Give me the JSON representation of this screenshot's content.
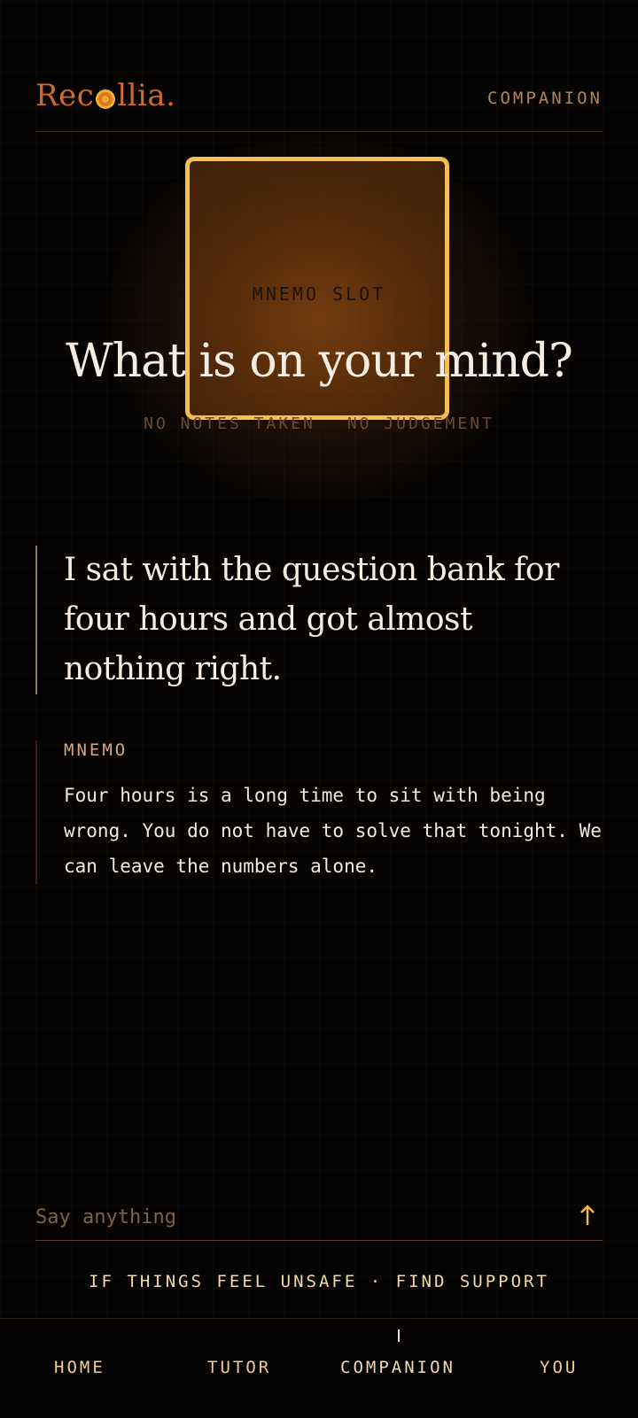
{
  "app": {
    "brand_prefix": "Rec",
    "brand_suffix": "llia",
    "brand_dot": ".",
    "section_label": "COMPANION"
  },
  "slot": {
    "label": "MNEMO SLOT"
  },
  "hero": {
    "title": "What is on your mind?",
    "subtitle_left": "NO NOTES TAKEN",
    "subtitle_right": "NO JUDGEMENT"
  },
  "conversation": {
    "user_message": "I sat with the question bank for four hours and got almost nothing right.",
    "reply_author": "MNEMO",
    "reply_text": "Four hours is a long time to sit with being wrong. You do not have to solve that tonight. We can leave the numbers alone."
  },
  "composer": {
    "placeholder": "Say anything",
    "value": "",
    "send_icon": "arrow-up-icon"
  },
  "support": {
    "left": "IF THINGS FEEL UNSAFE",
    "separator": "·",
    "right": "FIND SUPPORT"
  },
  "nav": {
    "items": [
      {
        "label": "HOME"
      },
      {
        "label": "TUTOR"
      },
      {
        "label": "COMPANION"
      },
      {
        "label": "YOU"
      }
    ],
    "active": "COMPANION"
  },
  "colors": {
    "background": "#050403",
    "accent": "#f4bf52",
    "brand": "#cf6a2c",
    "text": "#f3eadf"
  }
}
